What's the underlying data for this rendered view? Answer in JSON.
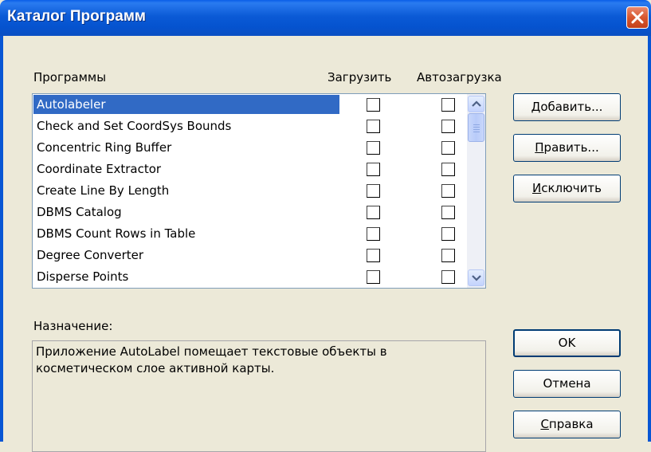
{
  "window": {
    "title": "Каталог Программ",
    "title_bar_color": "#0a5ee8",
    "close_icon": "close-x-icon"
  },
  "headers": {
    "programs": "Программы",
    "load": "Загрузить",
    "autoload": "Автозагрузка"
  },
  "programs": [
    {
      "name": "Autolabeler",
      "selected": true,
      "load": false,
      "autoload": false
    },
    {
      "name": "Check and Set CoordSys Bounds",
      "selected": false,
      "load": false,
      "autoload": false
    },
    {
      "name": "Concentric Ring Buffer",
      "selected": false,
      "load": false,
      "autoload": false
    },
    {
      "name": "Coordinate Extractor",
      "selected": false,
      "load": false,
      "autoload": false
    },
    {
      "name": "Create Line By Length",
      "selected": false,
      "load": false,
      "autoload": false
    },
    {
      "name": "DBMS Catalog",
      "selected": false,
      "load": false,
      "autoload": false
    },
    {
      "name": "DBMS Count Rows in Table",
      "selected": false,
      "load": false,
      "autoload": false
    },
    {
      "name": "Degree Converter",
      "selected": false,
      "load": false,
      "autoload": false
    },
    {
      "name": "Disperse Points",
      "selected": false,
      "load": false,
      "autoload": false
    }
  ],
  "buttons": {
    "add": {
      "mnemonic": "Д",
      "rest": "обавить..."
    },
    "edit": {
      "mnemonic": "П",
      "rest": "равить..."
    },
    "exclude": {
      "mnemonic": "И",
      "rest": "сключить"
    },
    "ok": "OK",
    "cancel": "Отмена",
    "help": {
      "mnemonic": "С",
      "rest": "правка"
    }
  },
  "description": {
    "label": "Назначение:",
    "line1": "Приложение AutoLabel помещает текстовые объекты в",
    "line2": "косметическом слое активной карты."
  },
  "colors": {
    "selection": "#316ac5",
    "dialog_background": "#ece9d8"
  }
}
